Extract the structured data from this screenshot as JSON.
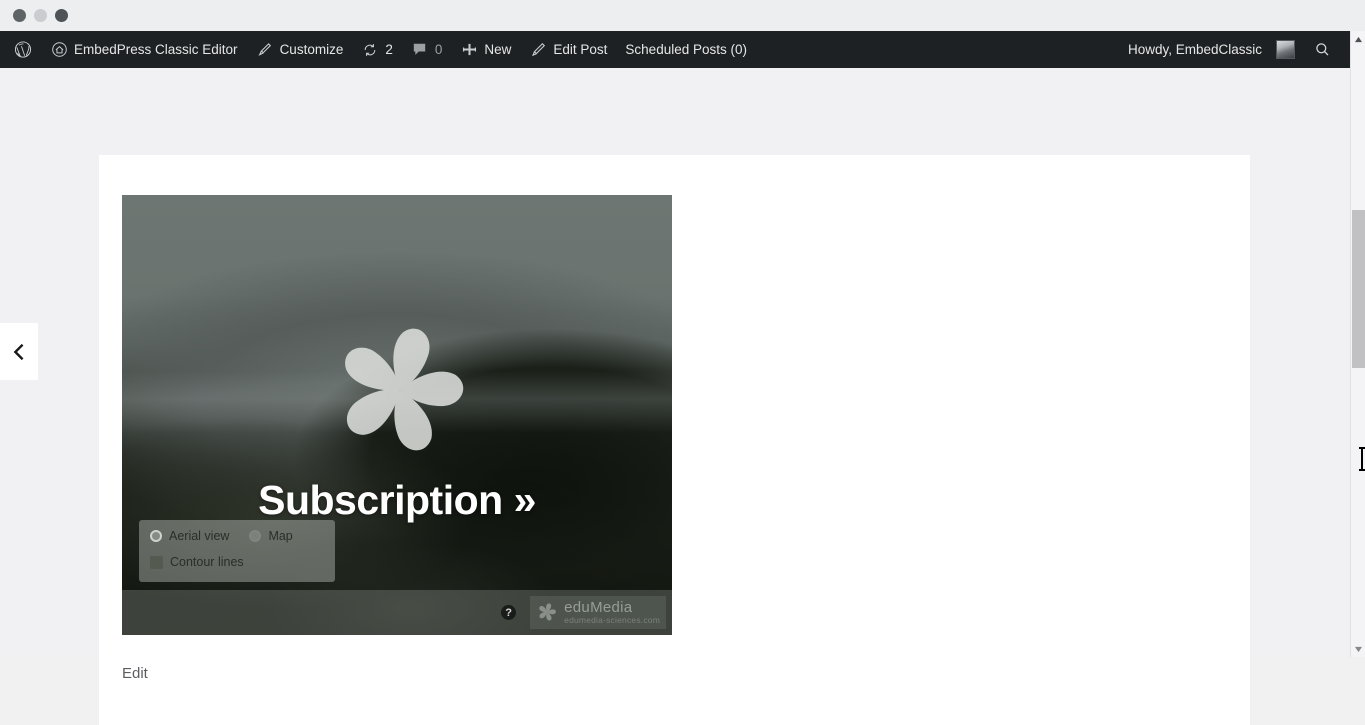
{
  "browser": {
    "window_controls": [
      "close",
      "minimize",
      "maximize"
    ]
  },
  "adminbar": {
    "wp_logo": "wordpress-logo-icon",
    "site": {
      "icon": "home-icon",
      "label": "EmbedPress Classic Editor"
    },
    "customize": {
      "icon": "brush-icon",
      "label": "Customize"
    },
    "updates": {
      "icon": "updates-icon",
      "count": "2"
    },
    "comments": {
      "icon": "comment-bubble-icon",
      "count": "0"
    },
    "new": {
      "icon": "plus-icon",
      "label": "New"
    },
    "edit_post": {
      "icon": "pencil-icon",
      "label": "Edit Post"
    },
    "scheduled_posts": {
      "label": "Scheduled Posts (0)"
    },
    "howdy": "Howdy, EmbedClassic",
    "avatar": "user-avatar",
    "search": "search-icon"
  },
  "embed": {
    "overlay_label": "Subscription »",
    "pinwheel": "edumedia-pinwheel-icon",
    "controls": {
      "aerial_view": "Aerial view",
      "map": "Map",
      "contour_lines": "Contour lines"
    },
    "help": "?",
    "brand": {
      "mark": "edumedia-pinwheel-icon",
      "name": "eduMedia",
      "url": "edumedia-sciences.com"
    }
  },
  "content": {
    "edit_link": "Edit"
  },
  "slider": {
    "prev": "chevron-left-icon"
  },
  "scrollbar": {
    "up": "scroll-up-arrow-icon",
    "down": "scroll-down-arrow-icon"
  },
  "colors": {
    "adminbar_bg": "#1d2124",
    "page_bg": "#f1f1f3",
    "card_bg": "#ffffff",
    "overlay_text": "#ffffff",
    "edit_link": "#5b5e60",
    "scrollbar_thumb": "#c1c1c3"
  }
}
